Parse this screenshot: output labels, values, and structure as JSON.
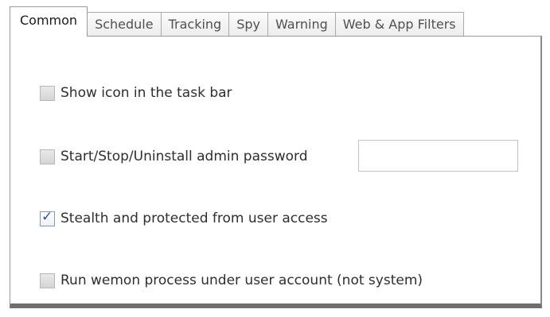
{
  "tabs": [
    {
      "label": "Common",
      "active": true
    },
    {
      "label": "Schedule",
      "active": false
    },
    {
      "label": "Tracking",
      "active": false
    },
    {
      "label": "Spy",
      "active": false
    },
    {
      "label": "Warning",
      "active": false
    },
    {
      "label": "Web & App Filters",
      "active": false
    }
  ],
  "options": {
    "show_icon": {
      "label": "Show icon in the task bar",
      "checked": false
    },
    "admin_password": {
      "label": "Start/Stop/Uninstall admin password",
      "checked": false,
      "value": "",
      "placeholder": ""
    },
    "stealth": {
      "label": "Stealth and protected from user access",
      "checked": true
    },
    "run_under_user": {
      "label": "Run wemon process under user account (not system)",
      "checked": false
    }
  },
  "icons": {
    "checkmark": "check-icon"
  },
  "colors": {
    "tab_border": "#a9a9a9",
    "checkmark": "#3a4a9a",
    "panel_bottom_border": "#6e6e6e"
  }
}
